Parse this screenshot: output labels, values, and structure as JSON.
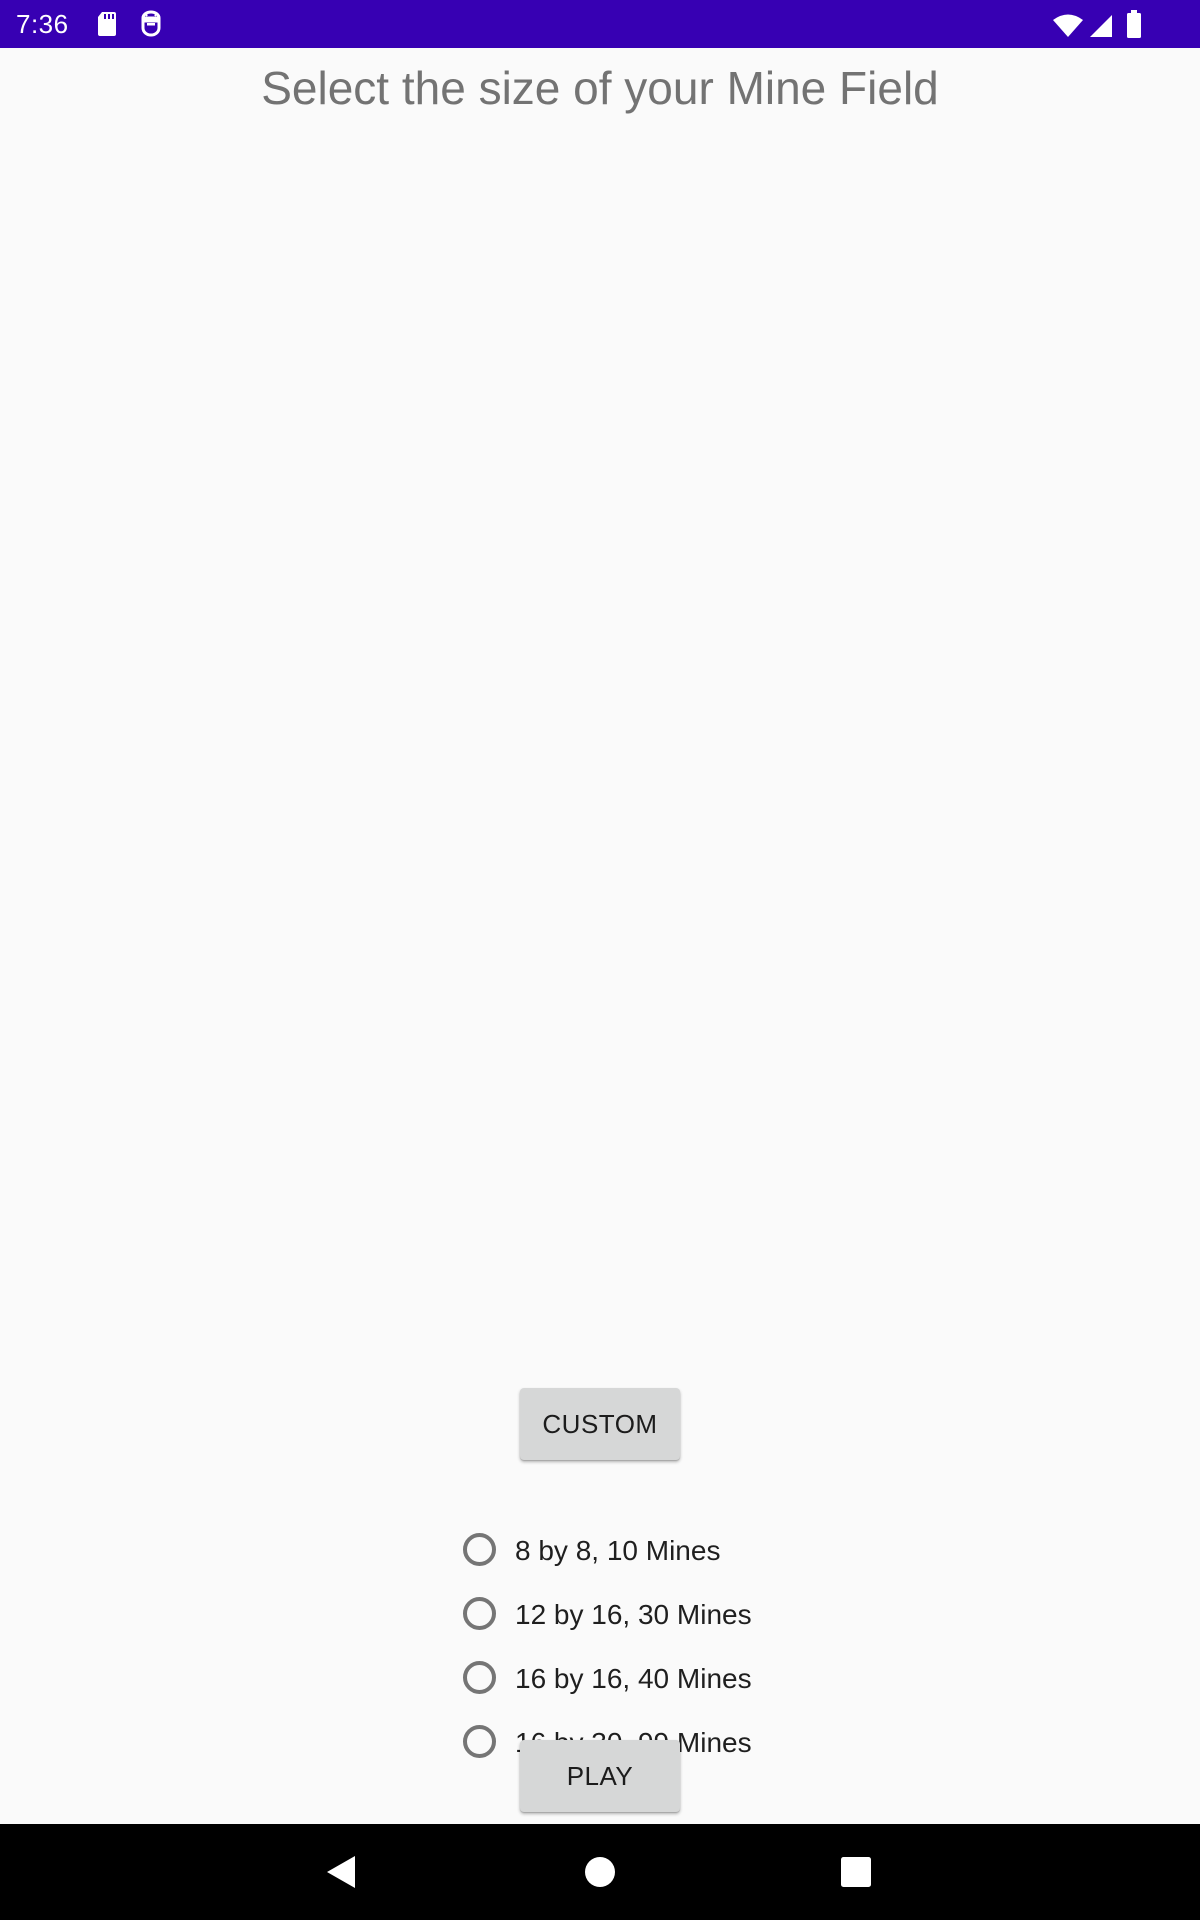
{
  "status_bar": {
    "time": "7:36",
    "color": "#3700b3",
    "left_icons": [
      "sd-card-icon",
      "android-debug-icon"
    ],
    "right_icons": [
      "wifi-icon",
      "cell-signal-icon",
      "battery-icon"
    ]
  },
  "screen": {
    "title": "Select the size of your Mine Field",
    "custom_button": "CUSTOM",
    "options": [
      {
        "label": "8 by 8, 10 Mines",
        "selected": false
      },
      {
        "label": "12 by 16, 30 Mines",
        "selected": false
      },
      {
        "label": "16 by 16, 40 Mines",
        "selected": false
      },
      {
        "label": "16 by 30, 99 Mines",
        "selected": false
      }
    ],
    "play_button": "PLAY"
  },
  "nav_bar": {
    "icons": [
      "back-icon",
      "home-icon",
      "recents-icon"
    ]
  }
}
